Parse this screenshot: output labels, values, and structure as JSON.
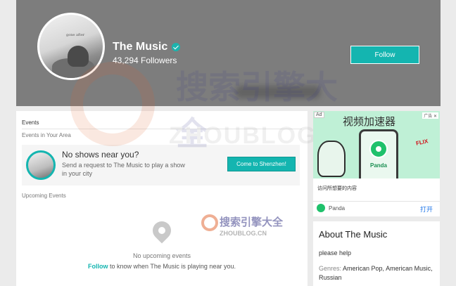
{
  "header": {
    "artist_name": "The Music",
    "followers": "43,294 Followers",
    "follow_label": "Follow",
    "avatar_caption": "gone after"
  },
  "watermark": {
    "text": "搜索引擎大全",
    "url": "ZHOUBLOG.CN"
  },
  "events": {
    "title": "Events",
    "in_area": "Events in Your Area",
    "no_shows": "No shows near you?",
    "request": "Send a request to The Music to play a show in your city",
    "come_button": "Come to Shenzhen!",
    "upcoming": "Upcoming Events",
    "no_upcoming": "No upcoming events",
    "follow_link": "Follow",
    "follow_rest": " to know when The Music is playing near you."
  },
  "ad": {
    "label": "Ad",
    "corner": "广告 ✕",
    "headline": "视频加速器",
    "app_label": "Panda",
    "netflix": "FLIX",
    "description": "访问所想要的内容",
    "brand": "Panda",
    "open": "打开"
  },
  "about": {
    "title": "About The Music",
    "text": "please help",
    "genres_label": "Genres: ",
    "genres": "American Pop, American Music, Russian"
  }
}
